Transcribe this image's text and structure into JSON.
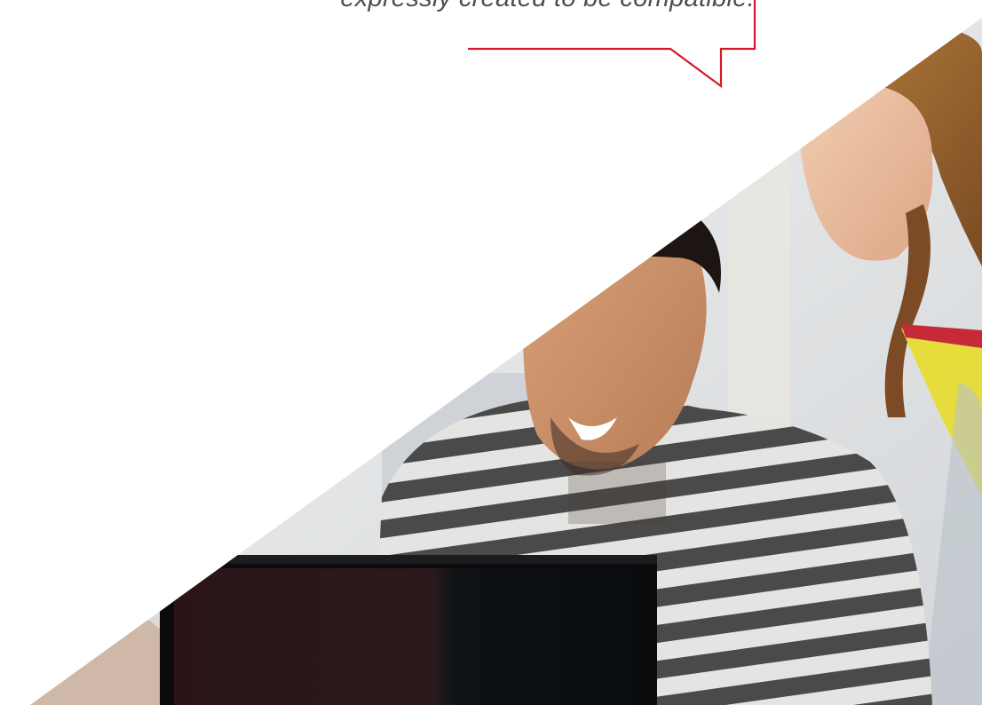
{
  "quote": {
    "text": "expressly created to be compatible."
  },
  "colors": {
    "accent": "#d7182a",
    "quote_text": "#4a4f55",
    "background": "#ffffff"
  },
  "photo": {
    "subject": "students-using-laptop"
  }
}
